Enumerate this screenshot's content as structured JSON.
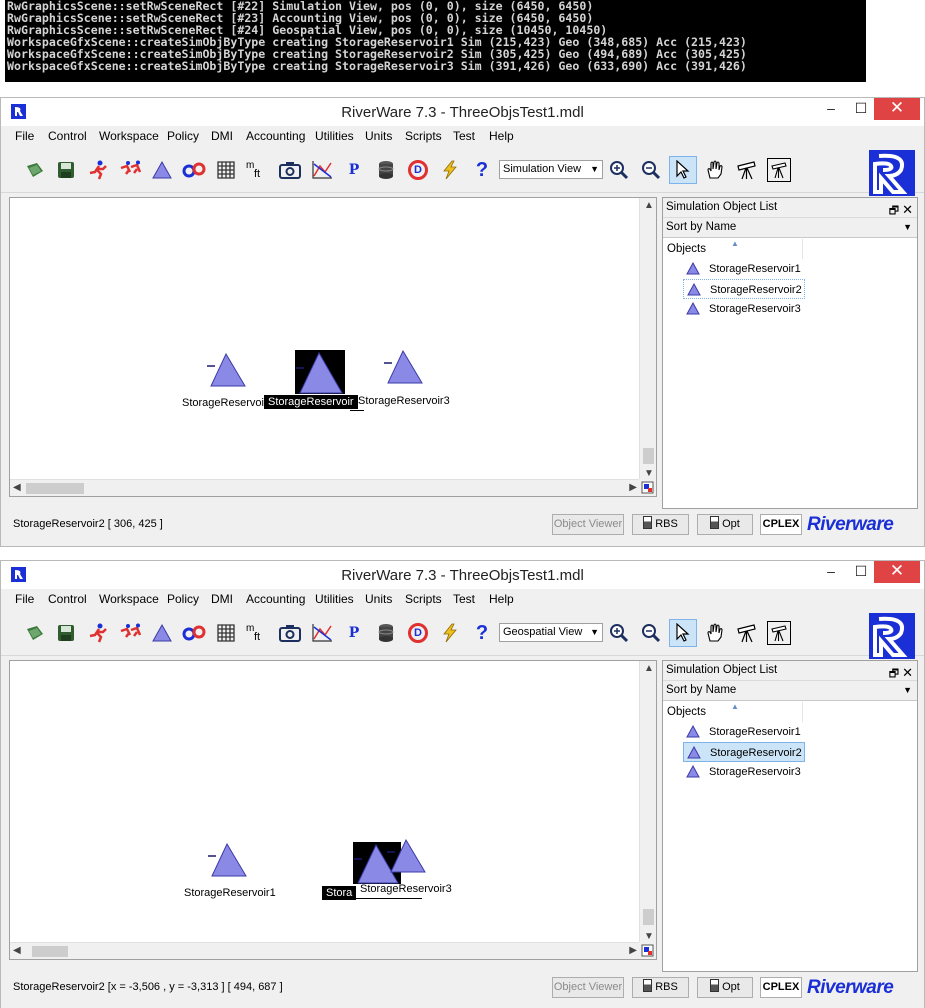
{
  "console": {
    "lines": [
      "RwGraphicsScene::setRwSceneRect [#22] Simulation View, pos (0, 0), size (6450, 6450)",
      "RwGraphicsScene::setRwSceneRect [#23] Accounting View, pos (0, 0), size (6450, 6450)",
      "RwGraphicsScene::setRwSceneRect [#24] Geospatial View, pos (0, 0), size (10450, 10450)",
      "WorkspaceGfxScene::createSimObjByType creating StorageReservoir1 Sim (215,423) Geo (348,685) Acc (215,423)",
      "WorkspaceGfxScene::createSimObjByType creating StorageReservoir2 Sim (305,425) Geo (494,689) Acc (305,425)",
      "WorkspaceGfxScene::createSimObjByType creating StorageReservoir3 Sim (391,426) Geo (633,690) Acc (391,426)"
    ]
  },
  "colors": {
    "reservoir_fill": "#8a8ae6",
    "selection": "#cce4f7",
    "brand_blue": "#1a2fd6",
    "close_button": "#e04343"
  },
  "windows": [
    {
      "title": "RiverWare 7.3 - ThreeObjsTest1.mdl",
      "controls": {
        "minimize": "–",
        "maximize": "☐",
        "close": "✕"
      },
      "menu": [
        "File",
        "Control",
        "Workspace",
        "Policy",
        "DMI",
        "Accounting",
        "Utilities",
        "Units",
        "Scripts",
        "Test",
        "Help"
      ],
      "toolbar": {
        "unit_icon_top": "m",
        "unit_icon_bottom": "ft",
        "view_select": "Simulation View",
        "dmi_letter": "D",
        "policy_letter": "P",
        "help_glyph": "?"
      },
      "canvas_objects": [
        {
          "label": "StorageReservoir",
          "selected": false
        },
        {
          "label": "StorageReservoir",
          "selected": true
        },
        {
          "label": "StorageReservoir3",
          "selected": false
        }
      ],
      "panel": {
        "title": "Simulation Object List",
        "sort_select": "Sort by Name",
        "column_header": "Objects",
        "items": [
          "StorageReservoir1",
          "StorageReservoir2",
          "StorageReservoir3"
        ],
        "selected_item": 1
      },
      "status": {
        "text": "StorageReservoir2 [ 306, 425 ]",
        "object_viewer": "Object Viewer",
        "rbs": "RBS",
        "opt": "Opt",
        "cplex": "CPLEX",
        "brand": "Riverware"
      }
    },
    {
      "title": "RiverWare 7.3 - ThreeObjsTest1.mdl",
      "controls": {
        "minimize": "–",
        "maximize": "☐",
        "close": "✕"
      },
      "menu": [
        "File",
        "Control",
        "Workspace",
        "Policy",
        "DMI",
        "Accounting",
        "Utilities",
        "Units",
        "Scripts",
        "Test",
        "Help"
      ],
      "toolbar": {
        "unit_icon_top": "m",
        "unit_icon_bottom": "ft",
        "view_select": "Geospatial View",
        "dmi_letter": "D",
        "policy_letter": "P",
        "help_glyph": "?"
      },
      "canvas_objects": [
        {
          "label": "StorageReservoir1",
          "selected": false
        },
        {
          "label": "Stora",
          "selected": true
        },
        {
          "label": "StorageReservoir3",
          "selected": false
        }
      ],
      "panel": {
        "title": "Simulation Object List",
        "sort_select": "Sort by Name",
        "column_header": "Objects",
        "items": [
          "StorageReservoir1",
          "StorageReservoir2",
          "StorageReservoir3"
        ],
        "selected_item": 1
      },
      "status": {
        "text": "StorageReservoir2 [x = -3,506 , y = -3,313 ] [ 494, 687 ]",
        "object_viewer": "Object Viewer",
        "rbs": "RBS",
        "opt": "Opt",
        "cplex": "CPLEX",
        "brand": "Riverware"
      }
    }
  ]
}
